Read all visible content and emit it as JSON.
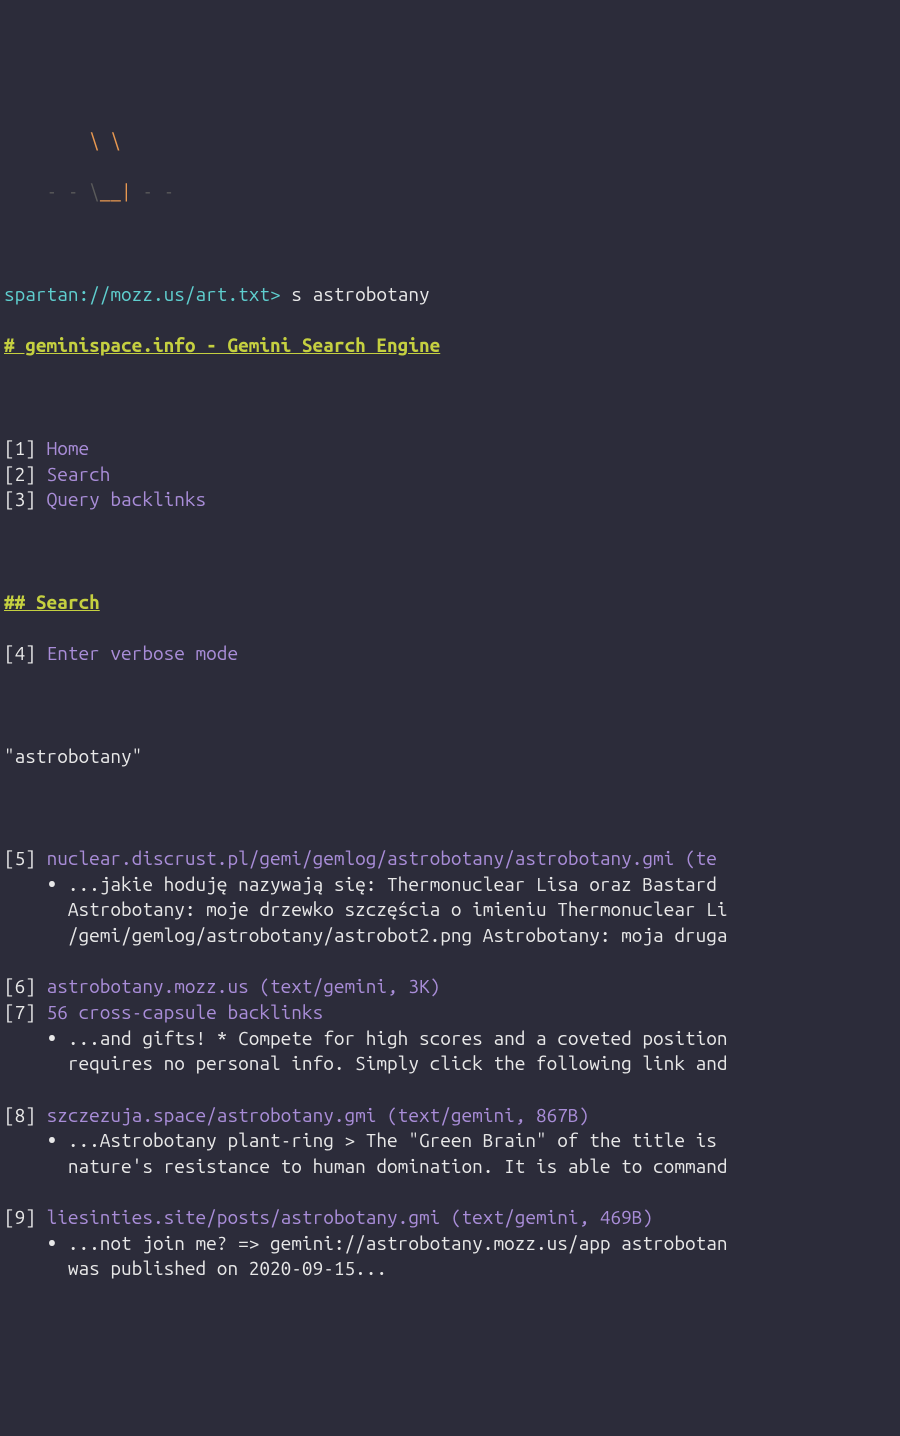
{
  "ascii": {
    "line1_gray_a": "        ",
    "line1_orange": "\\ \\",
    "line1_gray_b": "",
    "line2_gray_a": "    - - \\",
    "line2_orange": "__|",
    "line2_gray_b": " - -"
  },
  "prompt": {
    "url": "spartan://mozz.us/art.txt>",
    "command": " s astrobotany"
  },
  "heading1": "# geminispace.info - Gemini Search Engine",
  "nav": [
    {
      "num": "1",
      "label": "Home"
    },
    {
      "num": "2",
      "label": "Search"
    },
    {
      "num": "3",
      "label": "Query backlinks"
    }
  ],
  "heading2": "## Search",
  "option4": {
    "num": "4",
    "label": "Enter verbose mode"
  },
  "query": "\"astrobotany\"",
  "results": [
    {
      "num": "5",
      "link": "nuclear.discrust.pl/gemi/gemlog/astrobotany/astrobotany.gmi (te",
      "snippet": [
        "...jakie hoduję nazywają się: Thermonuclear Lisa oraz Bastard ",
        "Astrobotany: moje drzewko szczęścia o imieniu Thermonuclear Li",
        "/gemi/gemlog/astrobotany/astrobot2.png Astrobotany: moja druga"
      ]
    },
    {
      "num": "6",
      "link": "astrobotany.mozz.us (text/gemini, 3K)",
      "snippet": []
    },
    {
      "num": "7",
      "link": "56 cross-capsule backlinks",
      "snippet": [
        "...and gifts! * Compete for high scores and a coveted position",
        "requires no personal info. Simply click the following link and"
      ]
    },
    {
      "num": "8",
      "link": "szczezuja.space/astrobotany.gmi (text/gemini, 867B)",
      "snippet": [
        "...Astrobotany plant-ring > The \"Green Brain\" of the title is ",
        "nature's resistance to human domination. It is able to command"
      ]
    },
    {
      "num": "9",
      "link": "liesinties.site/posts/astrobotany.gmi (text/gemini, 469B)",
      "snippet": [
        "...not join me? => gemini://astrobotany.mozz.us/app astrobotan",
        "was published on 2020-09-15..."
      ]
    }
  ]
}
